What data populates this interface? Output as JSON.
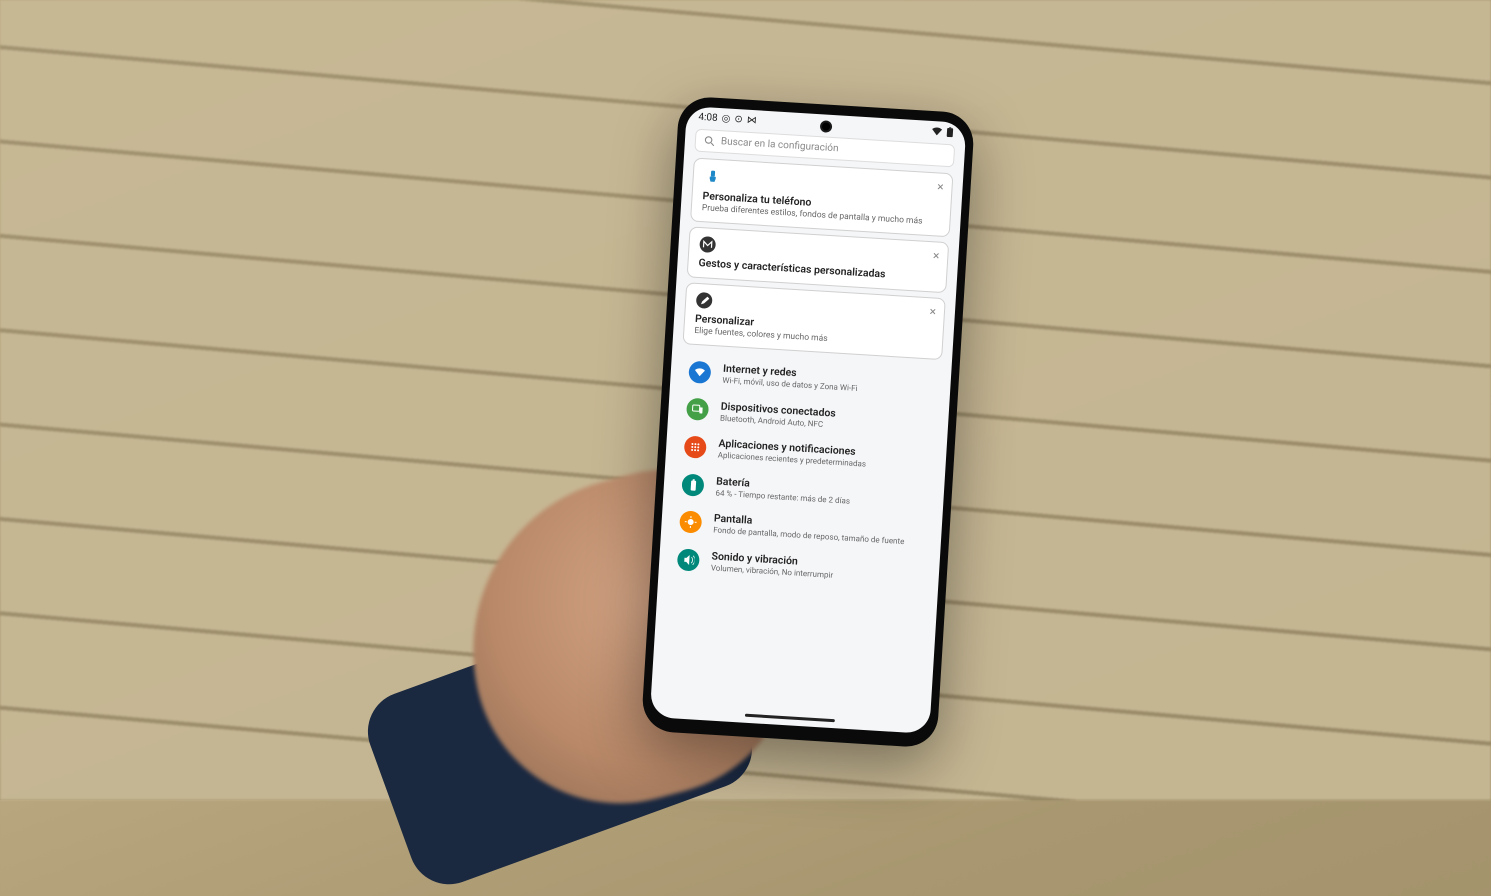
{
  "statusbar": {
    "time": "4:08"
  },
  "search": {
    "placeholder": "Buscar en la configuración"
  },
  "cards": [
    {
      "title": "Personaliza tu teléfono",
      "sub": "Prueba diferentes estilos, fondos de pantalla y mucho más",
      "iconColor": "#1e88c8"
    },
    {
      "title": "Gestos y características personalizadas",
      "sub": "",
      "iconColor": "#333"
    },
    {
      "title": "Personalizar",
      "sub": "Elige fuentes, colores y mucho más",
      "iconColor": "#333"
    }
  ],
  "rows": [
    {
      "title": "Internet y redes",
      "sub": "Wi-Fi, móvil, uso de datos y Zona Wi-Fi",
      "color": "#1976d2"
    },
    {
      "title": "Dispositivos conectados",
      "sub": "Bluetooth, Android Auto, NFC",
      "color": "#43a047"
    },
    {
      "title": "Aplicaciones y notificaciones",
      "sub": "Aplicaciones recientes y predeterminadas",
      "color": "#e64a19"
    },
    {
      "title": "Batería",
      "sub": "64 % - Tiempo restante: más de 2 días",
      "color": "#00897b"
    },
    {
      "title": "Pantalla",
      "sub": "Fondo de pantalla, modo de reposo, tamaño de fuente",
      "color": "#fb8c00"
    },
    {
      "title": "Sonido y vibración",
      "sub": "Volumen, vibración, No interrumpir",
      "color": "#00897b"
    }
  ]
}
